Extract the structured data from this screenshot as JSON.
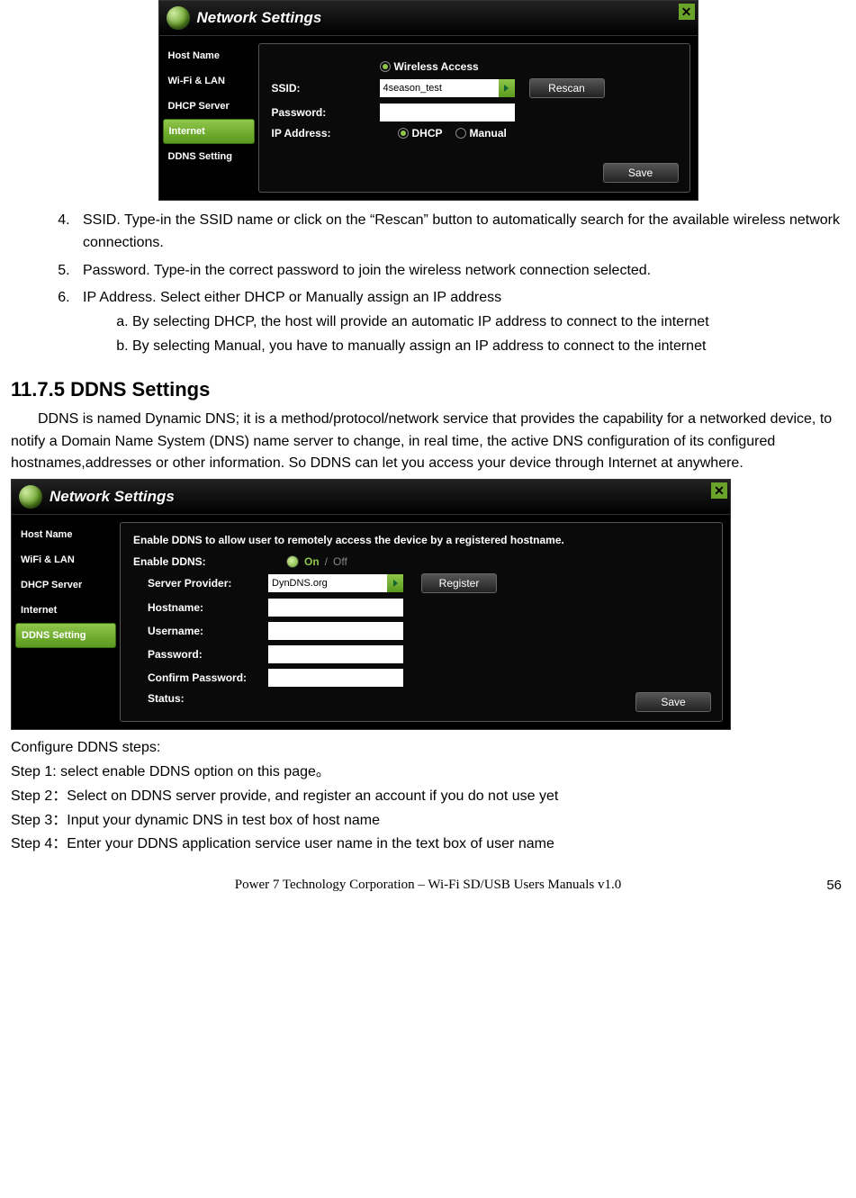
{
  "panel1": {
    "title": "Network Settings",
    "sidebar": [
      "Host Name",
      "Wi-Fi & LAN",
      "DHCP Server",
      "Internet",
      "DDNS Setting"
    ],
    "active_index": 3,
    "wireless_access": "Wireless Access",
    "ssid_label": "SSID:",
    "ssid_value": "4season_test",
    "password_label": "Password:",
    "password_value": "",
    "ipaddr_label": "IP Address:",
    "dhcp_label": "DHCP",
    "manual_label": "Manual",
    "rescan_btn": "Rescan",
    "save_btn": "Save"
  },
  "doc": {
    "items": [
      "SSID.    Type-in the SSID name or click on the “Rescan” button to automatically search for the available wireless network connections.",
      "Password.    Type-in the correct password to join the wireless network connection selected.",
      "IP Address.    Select either DHCP or Manually assign an IP address"
    ],
    "subs": [
      "By selecting DHCP, the host will provide an automatic IP address to connect to the internet",
      "By selecting Manual, you have to manually assign an IP address to connect to the internet"
    ],
    "section_title": "11.7.5 DDNS Settings",
    "section_para": "DDNS is named Dynamic DNS; it is a method/protocol/network service that provides the capability for a networked device, to notify a Domain Name System (DNS) name server to change, in real time, the active DNS configuration of its configured hostnames,addresses or other information. So DDNS can let you access your device through Internet at anywhere."
  },
  "panel2": {
    "title": "Network Settings",
    "sidebar": [
      "Host Name",
      "WiFi & LAN",
      "DHCP Server",
      "Internet",
      "DDNS Setting"
    ],
    "active_index": 4,
    "instruction": "Enable DDNS to allow user to remotely access the device by a registered hostname.",
    "enable_label": "Enable DDNS:",
    "toggle_on": "On",
    "toggle_off": "Off",
    "server_label": "Server Provider:",
    "server_value": "DynDNS.org",
    "register_btn": "Register",
    "hostname_label": "Hostname:",
    "username_label": "Username:",
    "password_label": "Password:",
    "confirm_label": "Confirm Password:",
    "status_label": "Status:",
    "save_btn": "Save"
  },
  "steps": {
    "intro": "Configure DDNS steps:",
    "s1": "Step 1: select enable DDNS option on this page。",
    "s2": "Step 2：Select on DDNS server provide, and register an account if you do not use yet",
    "s3": "Step 3：Input your dynamic DNS in test box of host name",
    "s4": "Step 4：Enter your DDNS application service user name in the text box of user name"
  },
  "footer": {
    "text": "Power 7 Technology Corporation – Wi-Fi SD/USB Users Manuals v1.0",
    "page": "56"
  }
}
